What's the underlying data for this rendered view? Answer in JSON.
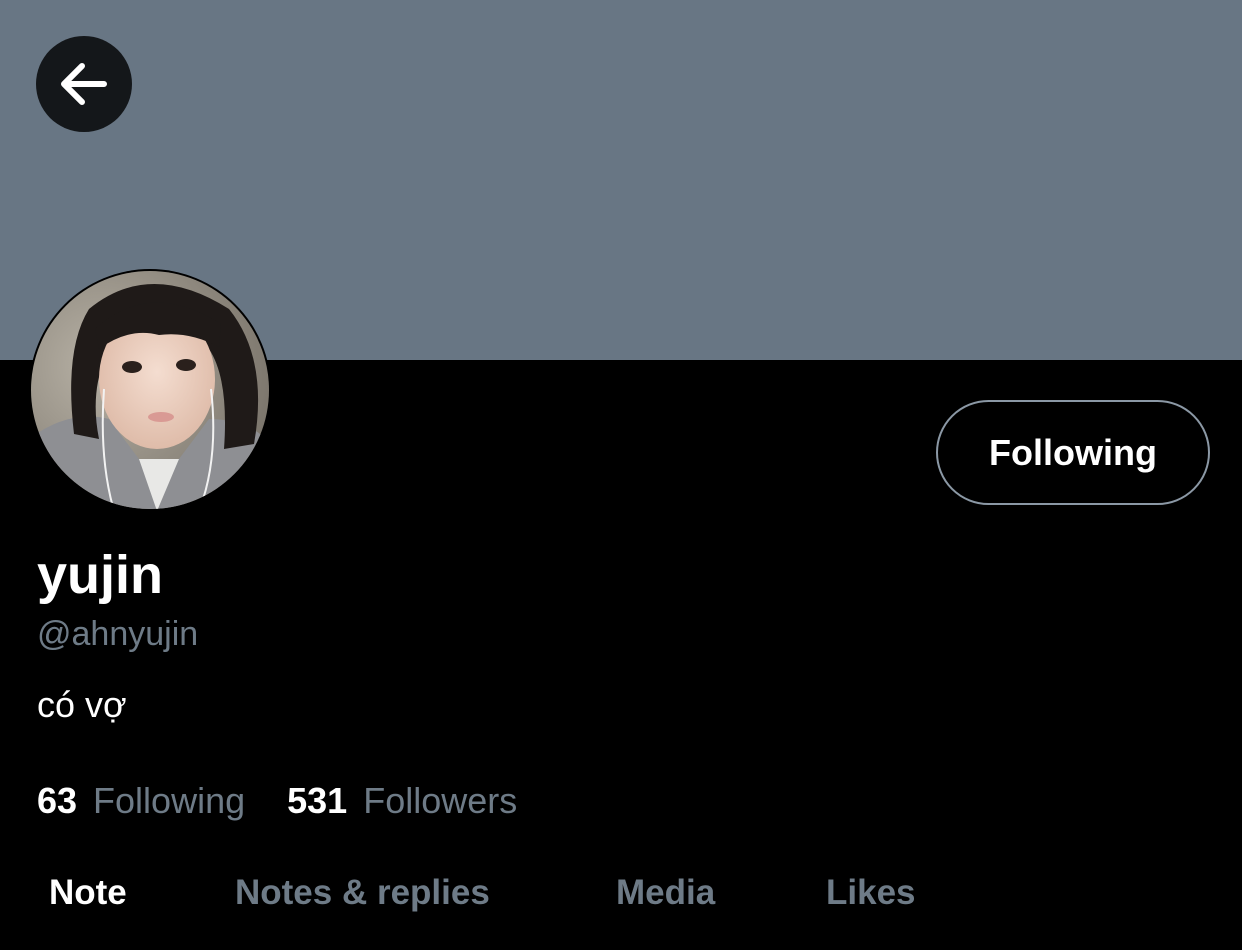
{
  "header": {
    "back_icon": "arrow-left-icon"
  },
  "profile": {
    "display_name": "yujin",
    "handle": "@ahnyujin",
    "bio": "có vợ",
    "follow_button_label": "Following"
  },
  "stats": {
    "following_count": "63",
    "following_label": "Following",
    "followers_count": "531",
    "followers_label": "Followers"
  },
  "tabs": [
    {
      "label": "Note",
      "active": true
    },
    {
      "label": "Notes & replies",
      "active": false
    },
    {
      "label": "Media",
      "active": false
    },
    {
      "label": "Likes",
      "active": false
    }
  ],
  "colors": {
    "banner": "#687684",
    "background": "#000000",
    "secondary_text": "#6e7b87",
    "button_border": "#8b98a5"
  }
}
